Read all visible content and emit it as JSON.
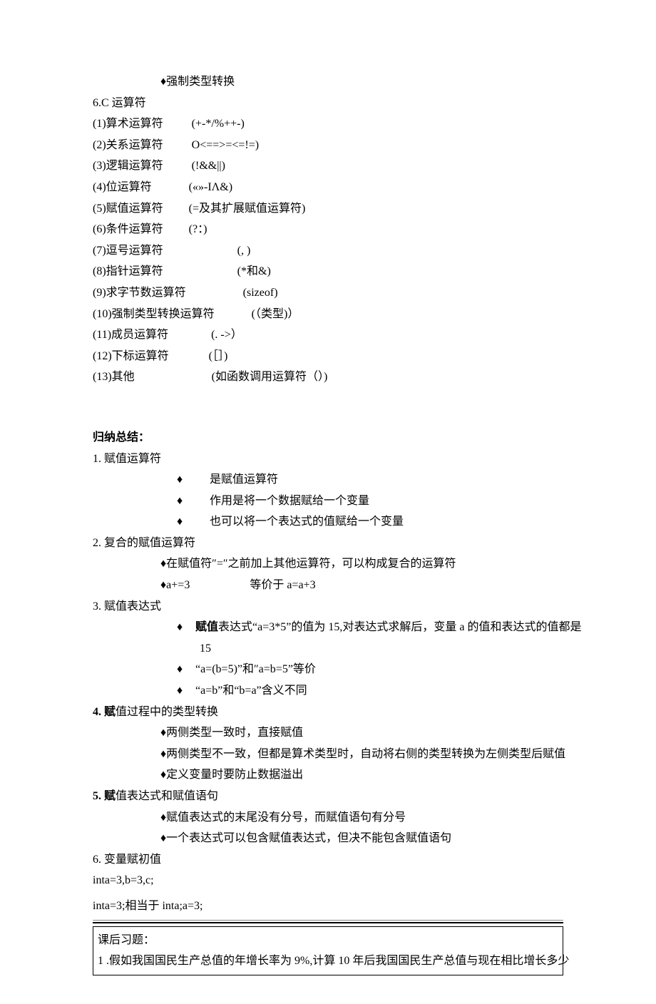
{
  "top": {
    "forced_cast": "♦强制类型转换"
  },
  "section6": {
    "title": "6.C 运算符",
    "items": [
      {
        "label": "(1)算术运算符",
        "sym": "(+-*/%++-)"
      },
      {
        "label": "(2)关系运算符",
        "sym": "O<==>=<=!=)"
      },
      {
        "label": "(3)逻辑运算符",
        "sym": "(!&&||)"
      },
      {
        "label": "(4)位运算符",
        "sym": "(«»-IΛ&)"
      },
      {
        "label": "(5)赋值运算符",
        "sym": "(=及其扩展赋值运算符)"
      },
      {
        "label": "(6)条件运算符",
        "sym": "(?：)"
      },
      {
        "label": "(7)逗号运算符",
        "sym": "(, )"
      },
      {
        "label": "(8)指针运算符",
        "sym": "(*和&)"
      },
      {
        "label": "(9)求字节数运算符",
        "sym": "(sizeof)"
      },
      {
        "label": "(10)强制类型转换运算符",
        "sym": "(（类型)）"
      },
      {
        "label": "(11)成员运算符",
        "sym": "(. ->）"
      },
      {
        "label": "(12)下标运算符",
        "sym": "(［］)"
      },
      {
        "label": "(13)其他",
        "sym": "(如函数调用运算符（）)"
      }
    ]
  },
  "summary_heading": "归纳总结：",
  "s1": {
    "title": "1. 赋值运算符",
    "b1": "是赋值运算符",
    "b2": "作用是将一个数据赋给一个变量",
    "b3": "也可以将一个表达式的值赋给一个变量"
  },
  "s2": {
    "title": "2. 复合的赋值运算符",
    "b1": "♦在赋值符″=″之前加上其他运算符，可以构成复合的运算符",
    "b2a": "♦a+=3",
    "b2b": "等价于 a=a+3"
  },
  "s3": {
    "title": "3. 赋值表达式",
    "b1a": "赋值",
    "b1b": "表达式“a=3*5”的值为 15,对表达式求解后，变量 a 的值和表达式的值都是",
    "b1c": "15",
    "b2": "“a=(b=5)”和″a=b=5”等价",
    "b3": "“a=b”和“b=a”含义不同"
  },
  "s4": {
    "title_a": "4. 赋",
    "title_b": "值过程中的类型转换",
    "b1": "♦两侧类型一致时，直接赋值",
    "b2": "♦两侧类型不一致，但都是算术类型时，自动将右侧的类型转换为左侧类型后赋值",
    "b3": "♦定义变量时要防止数据溢出"
  },
  "s5": {
    "title_a": "5. 赋",
    "title_b": "值表达式和赋值语句",
    "b1": "♦赋值表达式的末尾没有分号，而赋值语句有分号",
    "b2": "♦一个表达式可以包含赋值表达式，但决不能包含赋值语句"
  },
  "s6": {
    "title": "6. 变量赋初值",
    "l1": "inta=3,b=3,c;",
    "l2": "inta=3;相当于 inta;a=3;"
  },
  "footer": {
    "l1": "课后习题：",
    "l2": "1 .假如我国国民生产总值的年增长率为 9%,计算 10 年后我国国民生产总值与现在相比增长多少"
  }
}
